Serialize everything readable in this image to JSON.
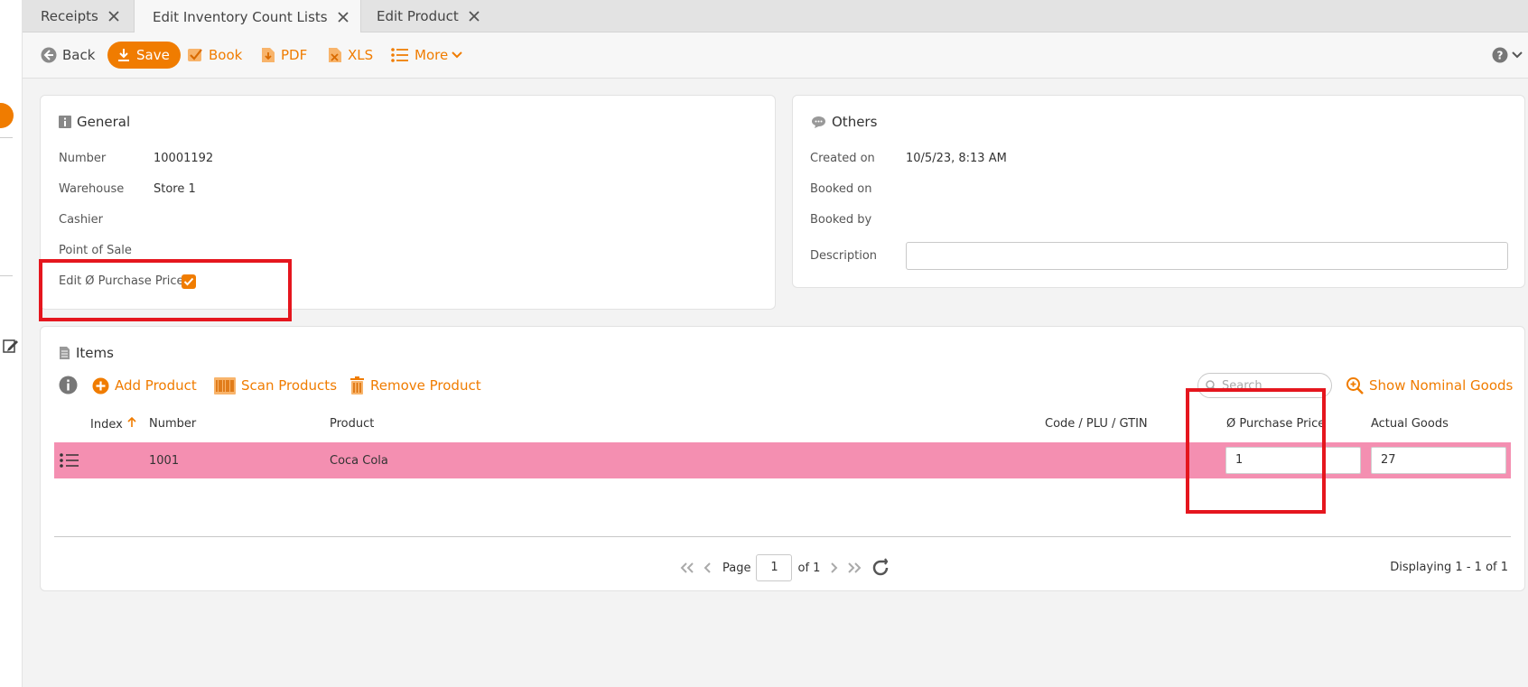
{
  "tabs": [
    {
      "label": "Receipts"
    },
    {
      "label": "Edit Inventory Count Lists"
    },
    {
      "label": "Edit Product"
    }
  ],
  "toolbar": {
    "back": "Back",
    "save": "Save",
    "book": "Book",
    "pdf": "PDF",
    "xls": "XLS",
    "more": "More"
  },
  "general": {
    "title": "General",
    "number_label": "Number",
    "number_value": "10001192",
    "warehouse_label": "Warehouse",
    "warehouse_value": "Store 1",
    "cashier_label": "Cashier",
    "pos_label": "Point of Sale",
    "edit_price_label": "Edit Ø Purchase Price",
    "edit_price_checked": true
  },
  "others": {
    "title": "Others",
    "created_label": "Created on",
    "created_value": "10/5/23, 8:13 AM",
    "booked_on_label": "Booked on",
    "booked_by_label": "Booked by",
    "description_label": "Description",
    "description_value": ""
  },
  "items": {
    "title": "Items",
    "add_product": "Add Product",
    "scan_products": "Scan Products",
    "remove_product": "Remove Product",
    "search_placeholder": "Search",
    "show_nominal": "Show Nominal Goods",
    "columns": {
      "index": "Index",
      "number": "Number",
      "product": "Product",
      "code": "Code / PLU / GTIN",
      "purchase_price": "Ø Purchase Price",
      "actual_goods": "Actual Goods"
    },
    "rows": [
      {
        "number": "1001",
        "product": "Coca Cola",
        "code": "",
        "purchase_price": "1",
        "actual_goods": "27"
      }
    ],
    "pager": {
      "page_label": "Page",
      "page_value": "1",
      "of_label": "of 1",
      "displaying": "Displaying 1 - 1 of 1"
    }
  },
  "colors": {
    "accent": "#f07c00",
    "row_highlight": "#f48fb1",
    "annotation": "#e5161e"
  }
}
